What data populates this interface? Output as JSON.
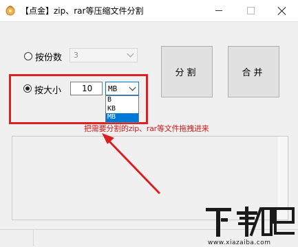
{
  "window": {
    "title": "【点金】zip、rar等压缩文件分割",
    "minimize_icon": "minimize-icon",
    "maximize_icon": "maximize-icon",
    "close_icon": "close-icon"
  },
  "split_mode": {
    "by_count": {
      "label": "按份数",
      "checked": false,
      "value": "3",
      "enabled": false
    },
    "by_size": {
      "label": "按大小",
      "checked": true,
      "value": "10",
      "unit_selected": "MB",
      "unit_options": [
        "B",
        "KB",
        "MB"
      ],
      "highlighted_option": "MB"
    }
  },
  "buttons": {
    "split_label": "分割",
    "merge_label": "合并"
  },
  "hint": "把需要分割的zip、rar等文件拖拽进来",
  "file_drop_area": {
    "content": ""
  },
  "colors": {
    "annotation_red": "#e02020",
    "selection_blue": "#0078d7"
  },
  "watermark": {
    "text": "下载吧",
    "url_text": "www.xiazaiba.com"
  }
}
